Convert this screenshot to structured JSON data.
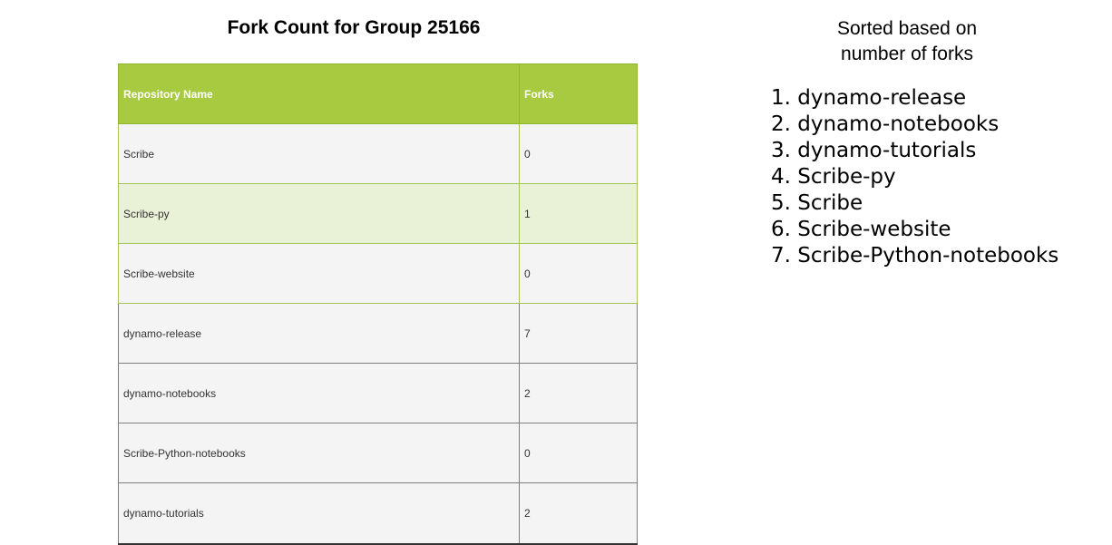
{
  "title": "Fork Count for Group 25166",
  "table": {
    "headers": {
      "name": "Repository Name",
      "forks": "Forks"
    },
    "rows": [
      {
        "name": "Scribe",
        "forks": "0"
      },
      {
        "name": "Scribe-py",
        "forks": "1"
      },
      {
        "name": "Scribe-website",
        "forks": "0"
      },
      {
        "name": "dynamo-release",
        "forks": "7"
      },
      {
        "name": "dynamo-notebooks",
        "forks": "2"
      },
      {
        "name": "Scribe-Python-notebooks",
        "forks": "0"
      },
      {
        "name": "dynamo-tutorials",
        "forks": "2"
      }
    ]
  },
  "sort_note": {
    "line1": "Sorted based on",
    "line2": "number of forks"
  },
  "sorted_list": [
    "1. dynamo-release",
    "2. dynamo-notebooks",
    "3. dynamo-tutorials",
    "4. Scribe-py",
    "5. Scribe",
    "6. Scribe-website",
    "7. Scribe-Python-notebooks"
  ],
  "colors": {
    "header_bg": "#a8ca41",
    "highlight_row_bg": "#e9f1d7",
    "row_bg": "#f4f4f4"
  }
}
